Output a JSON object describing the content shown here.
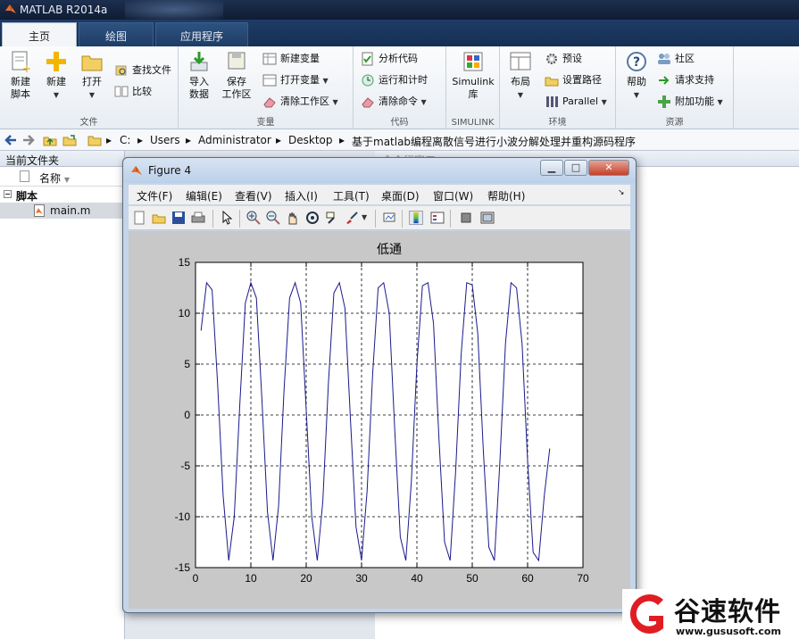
{
  "window": {
    "title": "MATLAB R2014a"
  },
  "tabs": [
    {
      "label": "主页",
      "active": true
    },
    {
      "label": "绘图",
      "active": false
    },
    {
      "label": "应用程序",
      "active": false
    }
  ],
  "ribbon": {
    "file": {
      "label": "文件",
      "new_script": [
        "新建",
        "脚本"
      ],
      "new": "新建",
      "open": "打开",
      "find_files": "查找文件",
      "compare": "比较"
    },
    "variable": {
      "label": "变量",
      "import_data": [
        "导入",
        "数据"
      ],
      "save_workspace": [
        "保存",
        "工作区"
      ],
      "new_variable": "新建变量",
      "open_variable": "打开变量",
      "clear_workspace": "清除工作区"
    },
    "code": {
      "label": "代码",
      "analyze": "分析代码",
      "run_time": "运行和计时",
      "clear_commands": "清除命令"
    },
    "simulink": {
      "label": "SIMULINK",
      "btn": [
        "Simulink",
        "库"
      ]
    },
    "environment": {
      "label": "环境",
      "layout": "布局",
      "preferences": "预设",
      "set_path": "设置路径",
      "parallel": "Parallel"
    },
    "resources": {
      "label": "资源",
      "help": "帮助",
      "community": "社区",
      "request_support": "请求支持",
      "addons": "附加功能"
    }
  },
  "address": {
    "crumbs": [
      "C:",
      "Users",
      "Administrator",
      "Desktop",
      "基于matlab编程离散信号进行小波分解处理并重构源码程序"
    ]
  },
  "current_folder": {
    "title": "当前文件夹",
    "column_name": "名称",
    "group": "脚本",
    "file": "main.m"
  },
  "command_window": {
    "title": "命令行窗口"
  },
  "figure": {
    "title": "Figure 4",
    "menu": [
      "文件(F)",
      "编辑(E)",
      "查看(V)",
      "插入(I)",
      "工具(T)",
      "桌面(D)",
      "窗口(W)",
      "帮助(H)"
    ],
    "tools": [
      "new-figure-icon",
      "open-file-icon",
      "save-icon",
      "print-icon",
      "pointer-icon",
      "zoom-in-icon",
      "zoom-out-icon",
      "pan-icon",
      "rotate-icon",
      "data-cursor-icon",
      "brush-icon",
      "link-icon",
      "colorbar-icon",
      "legend-icon",
      "hide-plot-tools-icon",
      "show-plot-tools-icon"
    ]
  },
  "chart_data": {
    "type": "line",
    "title": "低通",
    "xlabel": "",
    "ylabel": "",
    "xlim": [
      0,
      70
    ],
    "ylim": [
      -15,
      15
    ],
    "xticks": [
      0,
      10,
      20,
      30,
      40,
      50,
      60,
      70
    ],
    "yticks": [
      -15,
      -10,
      -5,
      0,
      5,
      10,
      15
    ],
    "grid": true,
    "line_color": "#1a1a8c",
    "series": [
      {
        "x": [
          1,
          2,
          3,
          4,
          5,
          6,
          7,
          8,
          9,
          10,
          11,
          12,
          13,
          14,
          15,
          16,
          17,
          18,
          19,
          20,
          21,
          22,
          23,
          24,
          25,
          26,
          27,
          28,
          29,
          30,
          31,
          32,
          33,
          34,
          35,
          36,
          37,
          38,
          39,
          40,
          41,
          42,
          43,
          44,
          45,
          46,
          47,
          48,
          49,
          50,
          51,
          52,
          53,
          54,
          55,
          56,
          57,
          58,
          59,
          60,
          61,
          62,
          63,
          64
        ],
        "values": [
          8.3,
          13.0,
          12.3,
          3.0,
          -8.0,
          -14.3,
          -10.0,
          1.0,
          11.0,
          13.0,
          11.5,
          1.5,
          -9.5,
          -14.3,
          -9.0,
          2.5,
          11.5,
          13.0,
          11.0,
          0.5,
          -10.0,
          -14.3,
          -8.5,
          3.0,
          12.0,
          13.0,
          10.5,
          -0.5,
          -11.0,
          -14.3,
          -7.5,
          4.0,
          12.5,
          13.0,
          10.0,
          -1.5,
          -12.0,
          -14.3,
          -6.5,
          5.0,
          12.7,
          13.0,
          9.0,
          -2.5,
          -12.5,
          -14.3,
          -5.5,
          6.0,
          13.0,
          12.8,
          8.0,
          -3.5,
          -13.0,
          -14.3,
          -4.5,
          7.0,
          13.0,
          12.5,
          7.0,
          -4.5,
          -13.5,
          -14.3,
          -8.0,
          -3.3
        ]
      }
    ]
  },
  "watermark": {
    "name": "谷速软件",
    "url": "www.gususoft.com"
  }
}
